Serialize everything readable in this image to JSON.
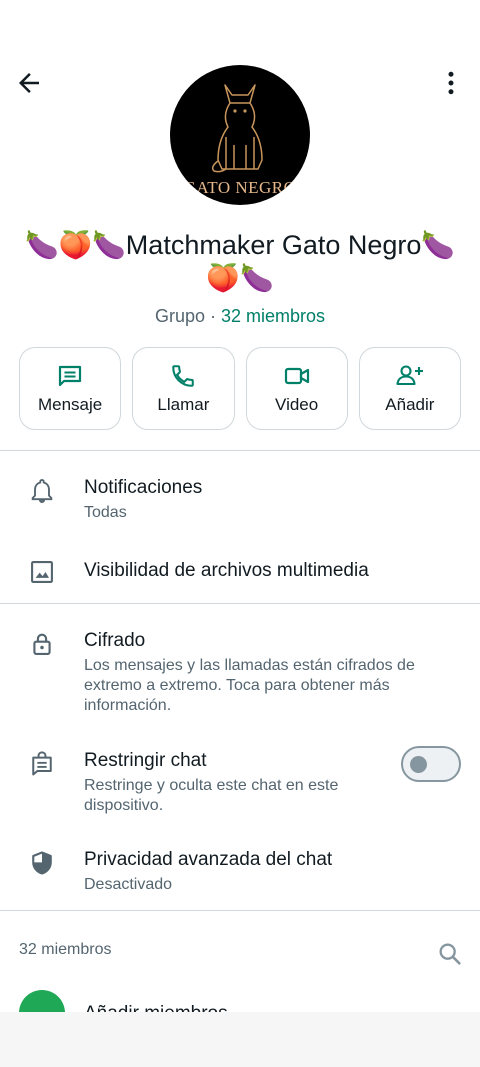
{
  "header": {
    "back_icon": "arrow-left-icon",
    "menu_icon": "more-vertical-icon"
  },
  "profile": {
    "avatar_text": "GATO NEGRO",
    "name": "🍆🍑🍆Matchmaker Gato Negro🍆🍑🍆",
    "type": "Grupo",
    "separator": " · ",
    "members": "32 miembros"
  },
  "actions": [
    {
      "label": "Mensaje",
      "icon": "message-icon"
    },
    {
      "label": "Llamar",
      "icon": "phone-icon"
    },
    {
      "label": "Video",
      "icon": "video-icon"
    },
    {
      "label": "Añadir",
      "icon": "add-person-icon"
    }
  ],
  "settings": {
    "notifications": {
      "title": "Notificaciones",
      "value": "Todas"
    },
    "media_visibility": {
      "title": "Visibilidad de archivos multimedia"
    },
    "encryption": {
      "title": "Cifrado",
      "desc": "Los mensajes y las llamadas están cifrados de extremo a extremo. Toca para obtener más información."
    },
    "restrict_chat": {
      "title": "Restringir chat",
      "desc": "Restringe y oculta este chat en este dispositivo.",
      "enabled": false
    },
    "advanced_privacy": {
      "title": "Privacidad avanzada del chat",
      "value": "Desactivado"
    }
  },
  "members_section": {
    "label": "32 miembros",
    "add_members_partial": "Añadir miembros"
  },
  "colors": {
    "accent": "#008069",
    "accent_green": "#1fa855",
    "text_primary": "#111b21",
    "text_secondary": "#54656f"
  }
}
